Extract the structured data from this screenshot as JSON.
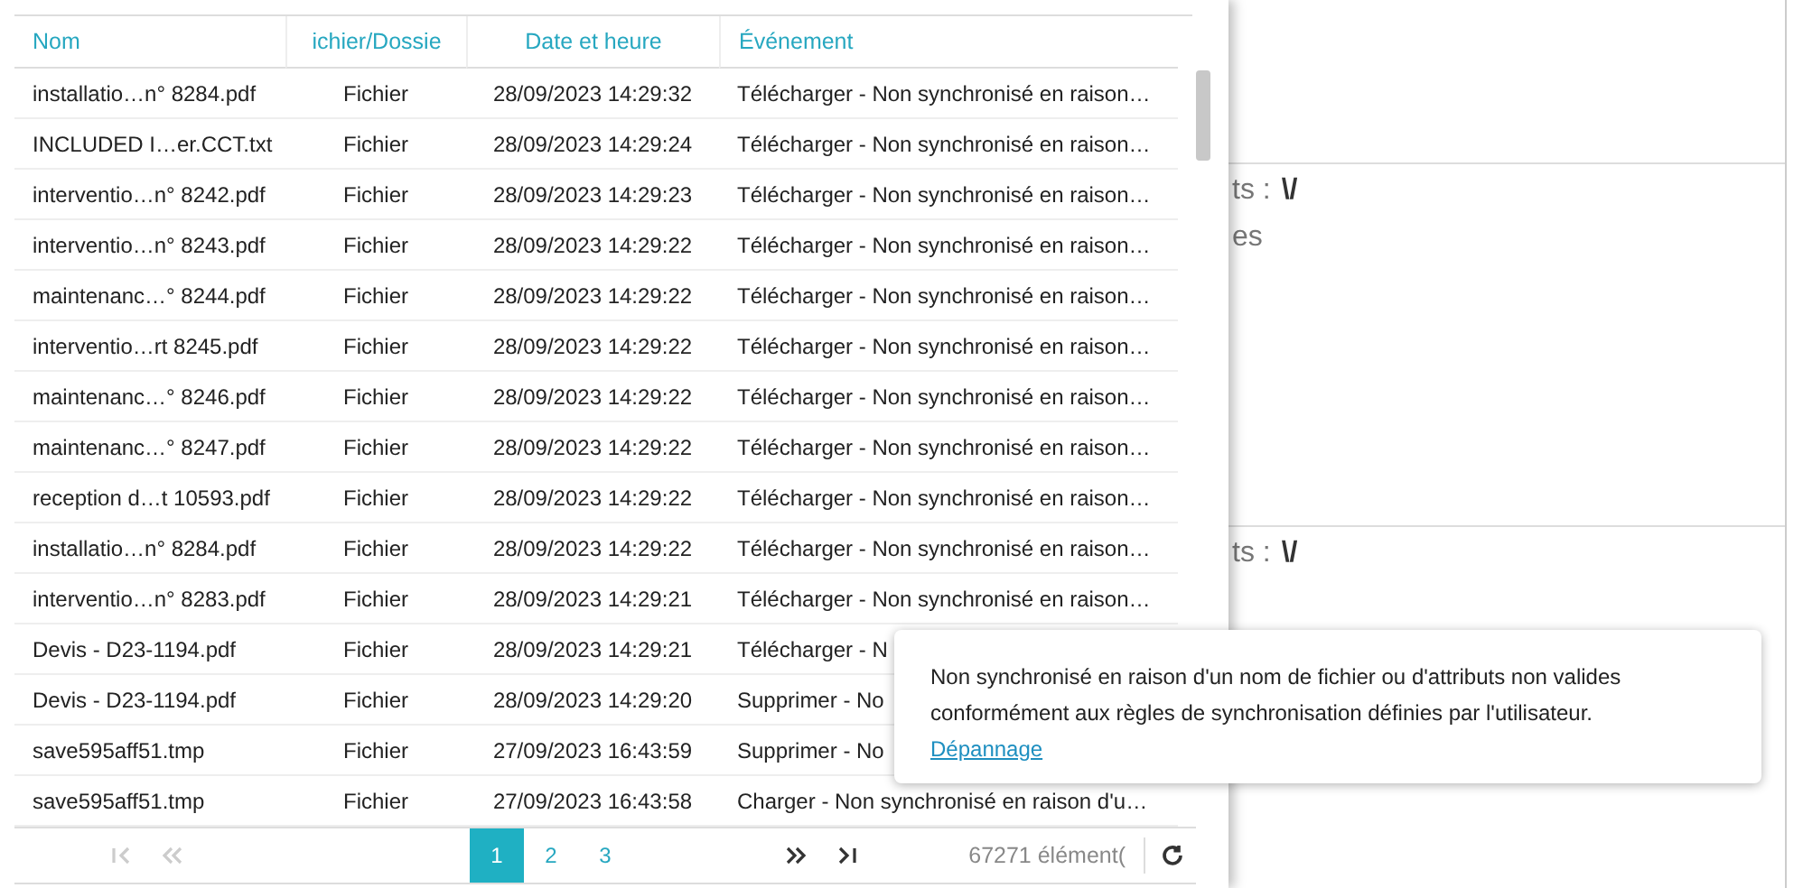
{
  "table": {
    "columns": [
      {
        "label": "Nom"
      },
      {
        "label": "ichier/Dossie"
      },
      {
        "label": "Date et heure"
      },
      {
        "label": "Événement"
      }
    ],
    "rows": [
      {
        "name": "installatio…n° 8284.pdf",
        "type": "Fichier",
        "date": "28/09/2023 14:29:32",
        "event": "Télécharger - Non synchronisé en raison…"
      },
      {
        "name": "INCLUDED I…er.CCT.txt",
        "type": "Fichier",
        "date": "28/09/2023 14:29:24",
        "event": "Télécharger - Non synchronisé en raison…"
      },
      {
        "name": "interventio…n° 8242.pdf",
        "type": "Fichier",
        "date": "28/09/2023 14:29:23",
        "event": "Télécharger - Non synchronisé en raison…"
      },
      {
        "name": "interventio…n° 8243.pdf",
        "type": "Fichier",
        "date": "28/09/2023 14:29:22",
        "event": "Télécharger - Non synchronisé en raison…"
      },
      {
        "name": "maintenanc…° 8244.pdf",
        "type": "Fichier",
        "date": "28/09/2023 14:29:22",
        "event": "Télécharger - Non synchronisé en raison…"
      },
      {
        "name": "interventio…rt 8245.pdf",
        "type": "Fichier",
        "date": "28/09/2023 14:29:22",
        "event": "Télécharger - Non synchronisé en raison…"
      },
      {
        "name": "maintenanc…° 8246.pdf",
        "type": "Fichier",
        "date": "28/09/2023 14:29:22",
        "event": "Télécharger - Non synchronisé en raison…"
      },
      {
        "name": "maintenanc…° 8247.pdf",
        "type": "Fichier",
        "date": "28/09/2023 14:29:22",
        "event": "Télécharger - Non synchronisé en raison…"
      },
      {
        "name": "reception d…t 10593.pdf",
        "type": "Fichier",
        "date": "28/09/2023 14:29:22",
        "event": "Télécharger - Non synchronisé en raison…"
      },
      {
        "name": "installatio…n° 8284.pdf",
        "type": "Fichier",
        "date": "28/09/2023 14:29:22",
        "event": "Télécharger - Non synchronisé en raison…"
      },
      {
        "name": "interventio…n° 8283.pdf",
        "type": "Fichier",
        "date": "28/09/2023 14:29:21",
        "event": "Télécharger - Non synchronisé en raison…"
      },
      {
        "name": "Devis - D23-1194.pdf",
        "type": "Fichier",
        "date": "28/09/2023 14:29:21",
        "event": "Télécharger - N"
      },
      {
        "name": "Devis - D23-1194.pdf",
        "type": "Fichier",
        "date": "28/09/2023 14:29:20",
        "event": "Supprimer - No"
      },
      {
        "name": "save595aff51.tmp",
        "type": "Fichier",
        "date": "27/09/2023 16:43:59",
        "event": "Supprimer - No"
      },
      {
        "name": "save595aff51.tmp",
        "type": "Fichier",
        "date": "27/09/2023 16:43:58",
        "event": "Charger - Non synchronisé en raison d'u…"
      }
    ]
  },
  "pager": {
    "first_disabled": true,
    "prev_disabled": true,
    "pages": [
      {
        "label": "1",
        "selected": true
      },
      {
        "label": "2",
        "selected": false
      },
      {
        "label": "3",
        "selected": false
      }
    ],
    "count": "67271 élément("
  },
  "background": {
    "sections": [
      {
        "lines": [
          {
            "label": "ts :",
            "value": "\\/"
          },
          {
            "label": "es"
          }
        ]
      },
      {
        "lines": [
          {
            "label": "ts :",
            "value": "\\/"
          }
        ]
      }
    ]
  },
  "tooltip": {
    "text": "Non synchronisé en raison d'un nom de fichier ou d'attributs non valides conformément aux règles de synchronisation définies par l'utilisateur.",
    "link": "Dépannage"
  }
}
